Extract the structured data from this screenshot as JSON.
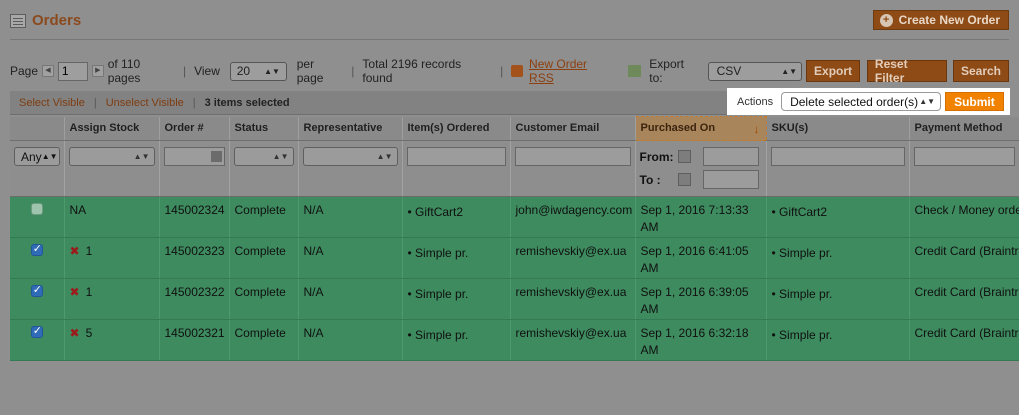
{
  "header": {
    "title": "Orders",
    "create_button": "Create New Order"
  },
  "pager": {
    "page_label": "Page",
    "page_value": "1",
    "of_pages": "of 110 pages",
    "view_label": "View",
    "view_value": "20",
    "per_page": "per page",
    "records": "Total 2196 records found",
    "rss_link": "New Order RSS",
    "export_label": "Export to:",
    "export_value": "CSV",
    "export_button": "Export",
    "reset_button": "Reset Filter",
    "search_button": "Search"
  },
  "massaction": {
    "select_visible": "Select Visible",
    "unselect_visible": "Unselect Visible",
    "selected": "3 items selected",
    "actions_label": "Actions",
    "action_value": "Delete selected order(s)",
    "submit": "Submit"
  },
  "columns": [
    "Assign Stock",
    "Order #",
    "Status",
    "Representative",
    "Item(s) Ordered",
    "Customer Email",
    "Purchased On",
    "SKU(s)",
    "Payment Method"
  ],
  "filters": {
    "any": "Any",
    "from": "From:",
    "to": "To :"
  },
  "rows": [
    {
      "checked": false,
      "stock_x": false,
      "stock": "NA",
      "order": "145002324",
      "status": "Complete",
      "rep": "N/A",
      "items": "• GiftCart2",
      "email": "john@iwdagency.com",
      "purchased": "Sep 1, 2016 7:13:33 AM",
      "sku": "• GiftCart2",
      "payment": "Check / Money order"
    },
    {
      "checked": true,
      "stock_x": true,
      "stock": "1",
      "order": "145002323",
      "status": "Complete",
      "rep": "N/A",
      "items": "• Simple pr.",
      "email": "remishevskiy@ex.ua",
      "purchased": "Sep 1, 2016 6:41:05 AM",
      "sku": "• Simple pr.",
      "payment": "Credit Card (Braintree)"
    },
    {
      "checked": true,
      "stock_x": true,
      "stock": "1",
      "order": "145002322",
      "status": "Complete",
      "rep": "N/A",
      "items": "• Simple pr.",
      "email": "remishevskiy@ex.ua",
      "purchased": "Sep 1, 2016 6:39:05 AM",
      "sku": "• Simple pr.",
      "payment": "Credit Card (Braintree)"
    },
    {
      "checked": true,
      "stock_x": true,
      "stock": "5",
      "order": "145002321",
      "status": "Complete",
      "rep": "N/A",
      "items": "• Simple pr.",
      "email": "remishevskiy@ex.ua",
      "purchased": "Sep 1, 2016 6:32:18 AM",
      "sku": "• Simple pr.",
      "payment": "Credit Card (Braintree)"
    }
  ],
  "colors": {
    "row_highlight": "#3d8b5f",
    "accent": "#f18200",
    "brand": "#8e4b16"
  }
}
